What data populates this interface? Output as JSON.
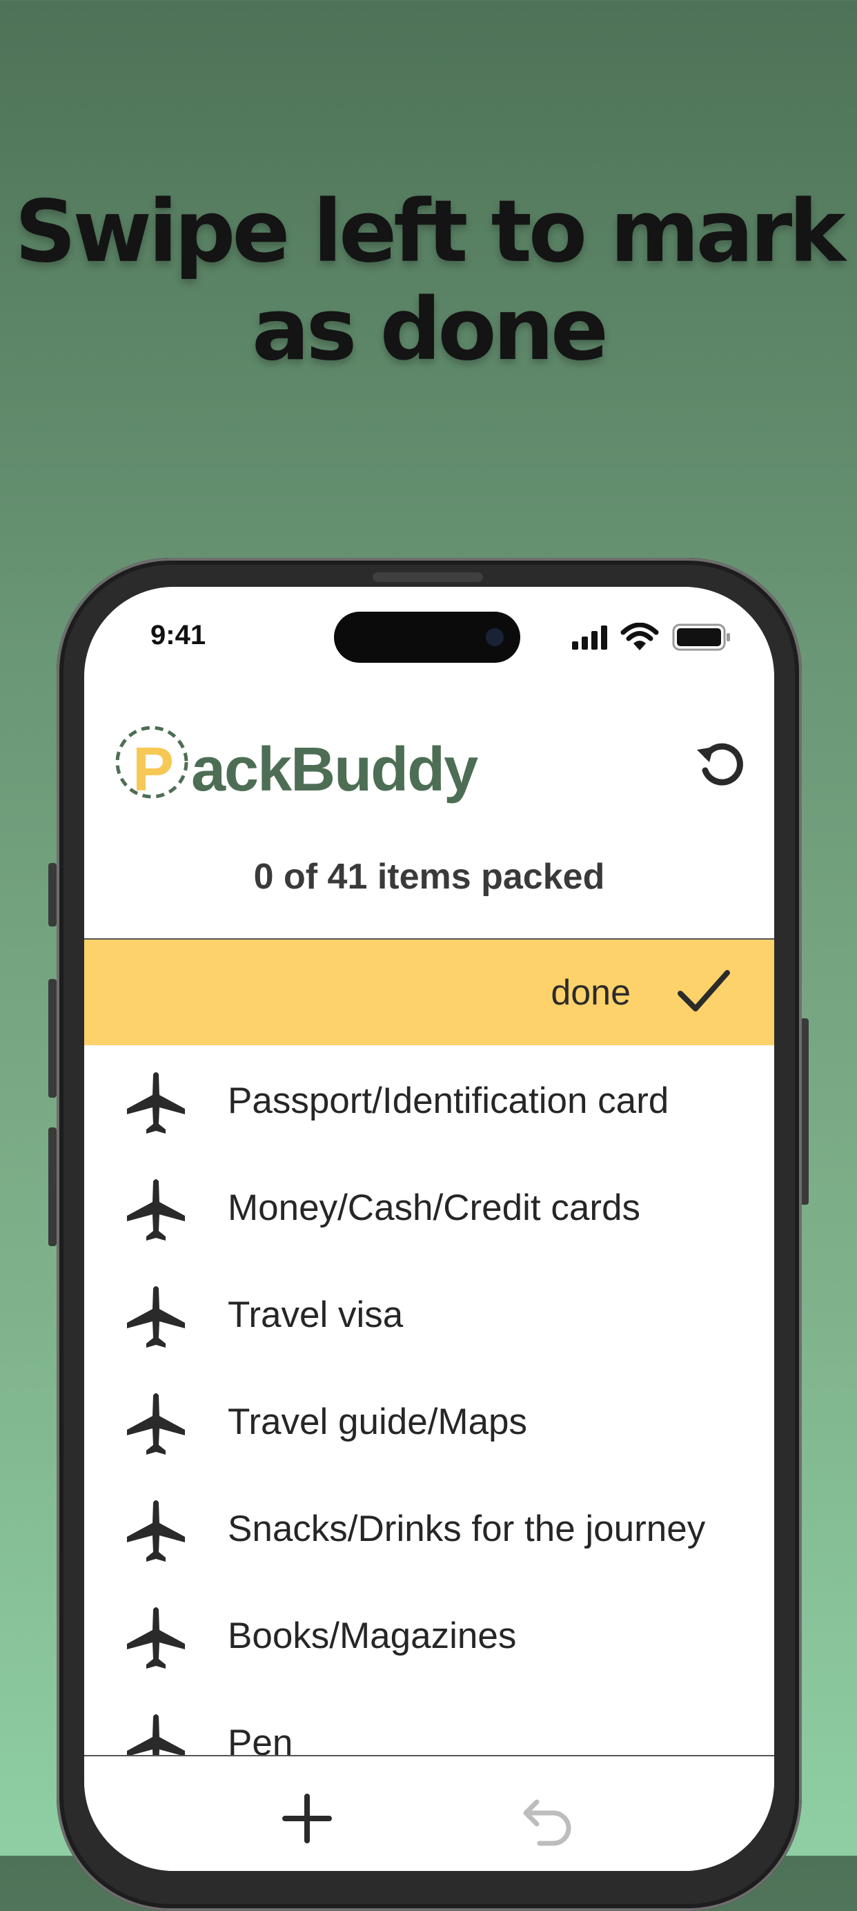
{
  "headline": {
    "line1": "Swipe left to mark",
    "line2": "as done"
  },
  "status_bar": {
    "time": "9:41"
  },
  "app": {
    "logo_letter": "P",
    "logo_rest": "ackBuddy",
    "packed_summary": "0 of 41 items packed",
    "swipe_action_label": "done"
  },
  "items": [
    {
      "label": "Passport/Identification card",
      "icon": "airplane-icon"
    },
    {
      "label": "Money/Cash/Credit cards",
      "icon": "airplane-icon"
    },
    {
      "label": "Travel visa",
      "icon": "airplane-icon"
    },
    {
      "label": "Travel guide/Maps",
      "icon": "airplane-icon"
    },
    {
      "label": "Snacks/Drinks for the journey",
      "icon": "airplane-icon"
    },
    {
      "label": "Books/Magazines",
      "icon": "airplane-icon"
    },
    {
      "label": "Pen",
      "icon": "airplane-icon"
    }
  ],
  "colors": {
    "accent_yellow": "#fdd26b",
    "logo_green": "#4d6e54",
    "logo_yellow": "#f6c855"
  }
}
